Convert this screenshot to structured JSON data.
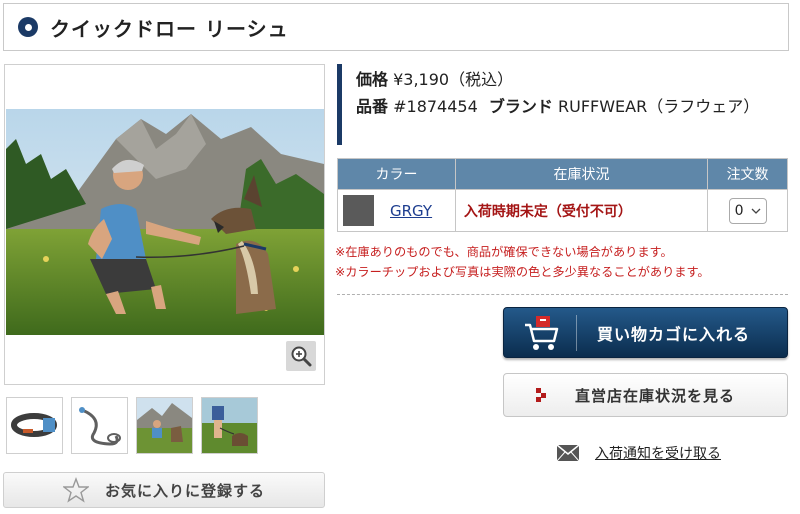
{
  "product": {
    "title": "クイックドロー リーシュ"
  },
  "info": {
    "price_label": "価格",
    "price_value": "¥3,190（税込）",
    "sku_label": "品番",
    "sku_value": "#1874454",
    "brand_label": "ブランド",
    "brand_value": "RUFFWEAR（ラフウェア）"
  },
  "stock_table": {
    "headers": [
      "カラー",
      "在庫状況",
      "注文数"
    ],
    "rows": [
      {
        "color_name": "GRGY",
        "swatch_color": "#5a5a5a",
        "status": "入荷時期未定（受付不可）",
        "quantity": "0"
      }
    ]
  },
  "notes": [
    "※在庫ありのものでも、商品が確保できない場合があります。",
    "※カラーチップおよび写真は実際の色と多少異なることがあります。"
  ],
  "buttons": {
    "cart": "買い物カゴに入れる",
    "store_stock": "直営店在庫状況を見る",
    "notify": "入荷通知を受け取る",
    "favorite": "お気に入りに登録する"
  },
  "icons": {
    "title_bullet": "circle-bullet-icon",
    "zoom": "zoom-in-icon",
    "cart": "shopping-cart-icon",
    "store": "store-marker-icon",
    "mail": "mail-icon",
    "favorite": "star-icon",
    "quantity_dropdown": "chevron-down-icon"
  },
  "colors": {
    "accent_navy": "#1b3a66",
    "table_header": "#5f87a9",
    "warning_red": "#c61f1f",
    "status_red": "#a41515",
    "link_blue": "#1d3d8f"
  }
}
